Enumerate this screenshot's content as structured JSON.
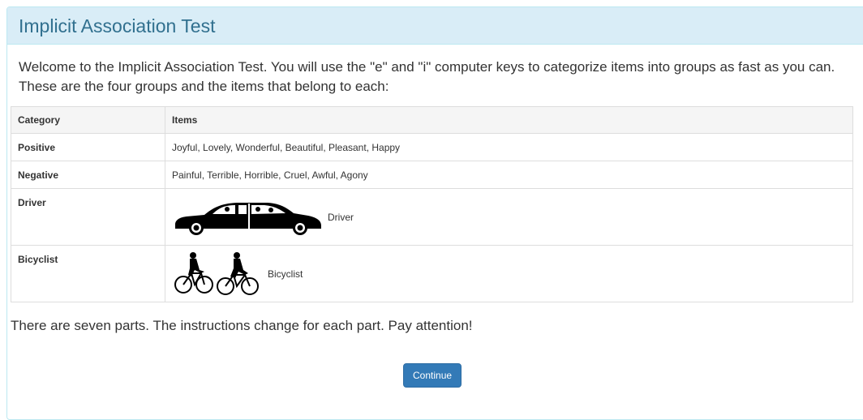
{
  "panel": {
    "title": "Implicit Association Test"
  },
  "intro_text": "Welcome to the Implicit Association Test. You will use the \"e\" and \"i\" computer keys to categorize items into groups as fast as you can. These are the four groups and the items that belong to each:",
  "table": {
    "headers": [
      "Category",
      "Items"
    ],
    "rows": [
      {
        "category": "Positive",
        "items": "Joyful, Lovely, Wonderful, Beautiful, Pleasant, Happy"
      },
      {
        "category": "Negative",
        "items": "Painful, Terrible, Horrible, Cruel, Awful, Agony"
      },
      {
        "category": "Driver",
        "items": "Driver",
        "icon": "car-icon"
      },
      {
        "category": "Bicyclist",
        "items": "Bicyclist",
        "icon": "bicyclist-icon"
      }
    ]
  },
  "outro_text": "There are seven parts. The instructions change for each part. Pay attention!",
  "continue_label": "Continue",
  "colors": {
    "heading_bg": "#d9edf7",
    "heading_text": "#31708f",
    "panel_border": "#bce8f1",
    "button_bg": "#337ab7"
  }
}
